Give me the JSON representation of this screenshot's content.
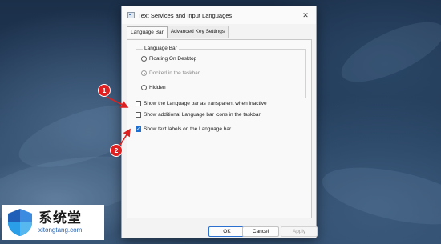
{
  "dialog": {
    "title": "Text Services and Input Languages",
    "close_glyph": "✕"
  },
  "tabs": [
    {
      "label": "Language Bar",
      "active": true
    },
    {
      "label": "Advanced Key Settings",
      "active": false
    }
  ],
  "language_bar_group": {
    "label": "Language Bar",
    "options": [
      {
        "label": "Floating On Desktop",
        "selected": false,
        "enabled": true
      },
      {
        "label": "Docked in the taskbar",
        "selected": true,
        "enabled": false
      },
      {
        "label": "Hidden",
        "selected": false,
        "enabled": true
      }
    ]
  },
  "checkboxes": [
    {
      "label": "Show the Language bar as transparent when inactive",
      "checked": false
    },
    {
      "label": "Show additional Language bar icons in the taskbar",
      "checked": false
    },
    {
      "label": "Show text labels on the Language bar",
      "checked": true
    }
  ],
  "buttons": {
    "ok": "OK",
    "cancel": "Cancel",
    "apply": "Apply"
  },
  "markers": [
    "1",
    "2"
  ],
  "logo": {
    "name": "系统堂",
    "url": "xitongtang.com"
  },
  "colors": {
    "marker": "#e02020",
    "accent": "#1f6fd0"
  }
}
